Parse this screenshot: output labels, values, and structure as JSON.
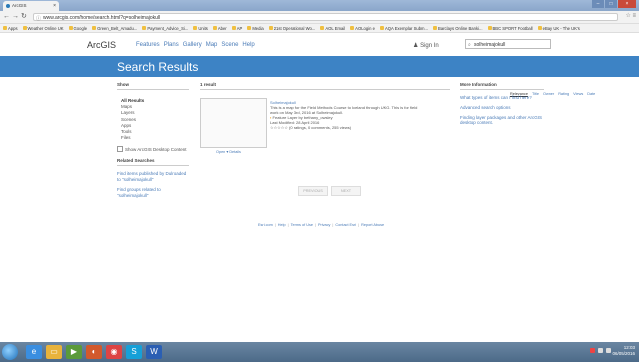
{
  "browser": {
    "tab_title": "ArcGIS",
    "url": "www.arcgis.com/home/search.html?q=solheimajokull",
    "bookmarks": [
      "Apps",
      "Weather Online UK",
      "Google",
      "Green_Belt_Amadu...",
      "Payment_Advice_Si...",
      "Units",
      "Aber",
      "AP",
      "Media",
      "21st Operational Wo...",
      "AOL Email",
      "AOLogin e",
      "AQA Exemplar Subm...",
      "Barclays Online Banki...",
      "BBC SPORT Football",
      "eBay UK - The UK's"
    ]
  },
  "header": {
    "logo": "ArcGIS",
    "nav": [
      "Features",
      "Plans",
      "Gallery",
      "Map",
      "Scene",
      "Help"
    ],
    "sign_in": "Sign In",
    "search_value": "solheimajokull"
  },
  "banner": {
    "title": "Search Results"
  },
  "left": {
    "show_heading": "Show",
    "show_items": [
      "All Results",
      "Maps",
      "Layers",
      "Scenes",
      "Apps",
      "Tools",
      "Files"
    ],
    "active_item": "All Results",
    "desktop_label": "Show ArcGIS Desktop Content",
    "related_heading": "Related Searches",
    "related_links": [
      "Find items published by Dulroaded to \"solheimajokull\"",
      "Find groups related to \"solheimajokull\""
    ]
  },
  "results": {
    "count": "1 result",
    "sort": [
      "Relevance",
      "Title",
      "Owner",
      "Rating",
      "Views",
      "Date"
    ],
    "item": {
      "title": "Solheimajokull",
      "description": "This is a map for the Field Methods Course to Iceland through UKG. This is for field work on May 3rd, 2016 at Solheimajokull.",
      "owner": "Feature Layer by bethany_owsley",
      "modified": "Last Modified: 28 April 2016",
      "rating": "☆☆☆☆☆ (0 ratings, 0 comments, 255 views)",
      "open": "Open ▾",
      "details": "Details"
    },
    "pager": [
      "PREVIOUS",
      "NEXT"
    ]
  },
  "more": {
    "heading": "More Information",
    "links": [
      "What types of items can I find here?",
      "Advanced search options",
      "Finding layer packages and other ArcGIS desktop content."
    ]
  },
  "footer": [
    "Esri.com",
    "Help",
    "Terms of Use",
    "Privacy",
    "Contact Esri",
    "Report Abuse"
  ],
  "taskbar": {
    "time": "12:03",
    "date": "06/05/2016"
  }
}
